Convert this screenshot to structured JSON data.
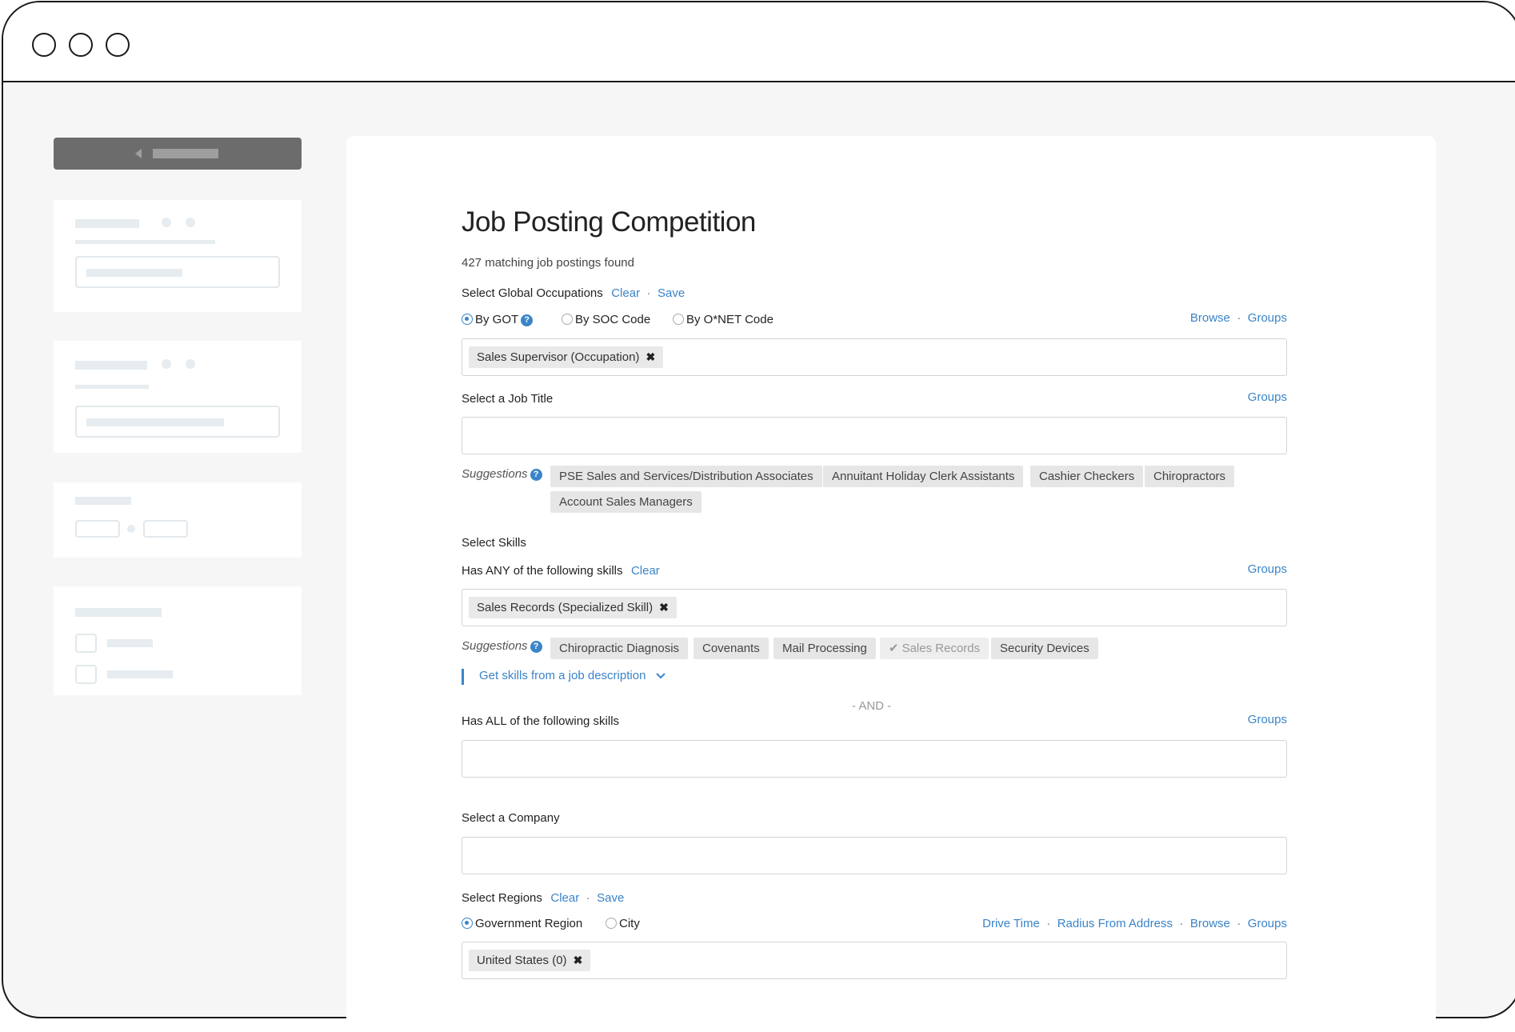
{
  "page": {
    "title": "Job Posting Competition",
    "result_count": "427 matching job postings found"
  },
  "occupations": {
    "label": "Select Global Occupations",
    "clear": "Clear",
    "save": "Save",
    "separator": "·",
    "radio_got": "By GOT",
    "radio_soc": "By SOC Code",
    "radio_onet": "By O*NET Code",
    "browse": "Browse",
    "groups": "Groups",
    "chip": "Sales Supervisor (Occupation)",
    "remove_glyph": "✖"
  },
  "job_title": {
    "label": "Select a Job Title",
    "groups": "Groups",
    "suggestions_label": "Suggestions",
    "suggestions": [
      "PSE Sales and Services/Distribution Associates",
      "Annuitant Holiday Clerk Assistants",
      "Cashier Checkers",
      "Chiropractors",
      "Account Sales Managers"
    ]
  },
  "skills": {
    "section_label": "Select Skills",
    "any_label": "Has ANY of the following skills",
    "clear": "Clear",
    "groups": "Groups",
    "chip": "Sales Records (Specialized Skill)",
    "suggestions_label": "Suggestions",
    "suggestions": [
      "Chiropractic Diagnosis",
      "Covenants",
      "Mail Processing",
      "Sales Records",
      "Security Devices"
    ],
    "selected_suggestion_glyph": "✔",
    "get_from_description": "Get skills from a job description",
    "and_divider": "- AND -",
    "all_label": "Has ALL of the following skills",
    "all_groups": "Groups"
  },
  "company": {
    "label": "Select a Company"
  },
  "regions": {
    "label": "Select Regions",
    "clear": "Clear",
    "save": "Save",
    "separator": "·",
    "radio_gov": "Government Region",
    "radio_city": "City",
    "drive_time": "Drive Time",
    "radius": "Radius From Address",
    "browse": "Browse",
    "groups": "Groups",
    "chip": "United States (0)"
  },
  "colors": {
    "link": "#3a84c9",
    "sidebar_button": "#6c6c6c",
    "background": "#f6f6f6"
  }
}
